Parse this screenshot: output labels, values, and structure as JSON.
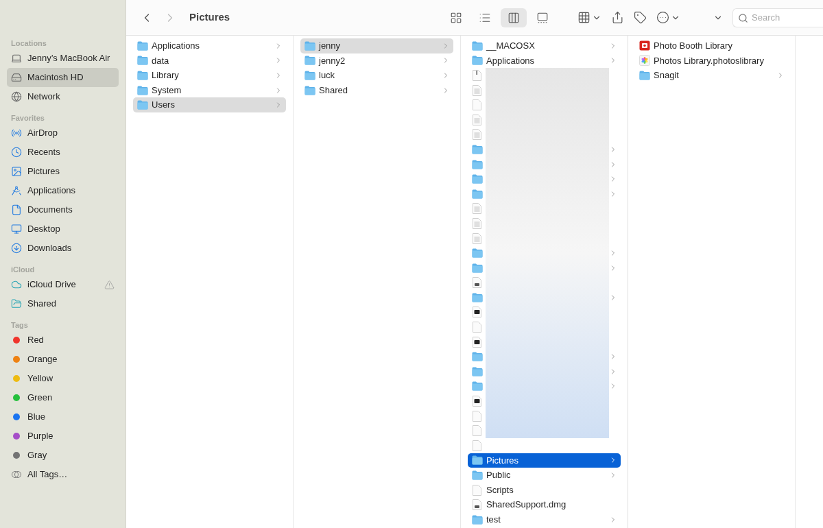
{
  "toolbar": {
    "back": {
      "disabled": false
    },
    "forward": {
      "disabled": true
    },
    "title": "Pictures",
    "views": [
      {
        "kind": "icons",
        "selected": false
      },
      {
        "kind": "list",
        "selected": false
      },
      {
        "kind": "columns",
        "selected": true
      },
      {
        "kind": "gallery",
        "selected": false
      }
    ],
    "actions": [
      {
        "kind": "group",
        "menu": true
      },
      {
        "kind": "share",
        "menu": false
      },
      {
        "kind": "tag",
        "menu": false
      },
      {
        "kind": "more",
        "menu": true
      },
      {
        "kind": "overflow",
        "menu": true
      }
    ],
    "search": {
      "placeholder": "Search"
    }
  },
  "sidebar": {
    "sections": [
      {
        "title": "Locations",
        "items": [
          {
            "label": "Jenny’s MacBook Air",
            "selected": false
          },
          {
            "label": "Macintosh HD",
            "selected": true
          },
          {
            "label": "Network",
            "selected": false
          }
        ]
      },
      {
        "title": "Favorites",
        "items": [
          {
            "label": "AirDrop",
            "selected": false
          },
          {
            "label": "Recents",
            "selected": false
          },
          {
            "label": "Pictures",
            "selected": false
          },
          {
            "label": "Applications",
            "selected": false
          },
          {
            "label": "Documents",
            "selected": false
          },
          {
            "label": "Desktop",
            "selected": false
          },
          {
            "label": "Downloads",
            "selected": false
          }
        ]
      },
      {
        "title": "iCloud",
        "items": [
          {
            "label": "iCloud Drive",
            "selected": false,
            "warning": true
          },
          {
            "label": "Shared",
            "selected": false,
            "warning": false
          }
        ]
      },
      {
        "title": "Tags",
        "items": [
          {
            "kind": "tag",
            "label": "Red",
            "color": "#f0352c",
            "selected": false
          },
          {
            "kind": "tag",
            "label": "Orange",
            "color": "#ee8212",
            "selected": false
          },
          {
            "kind": "tag",
            "label": "Yellow",
            "color": "#eebb12",
            "selected": false
          },
          {
            "kind": "tag",
            "label": "Green",
            "color": "#25c03c",
            "selected": false
          },
          {
            "kind": "tag",
            "label": "Blue",
            "color": "#1a74f0",
            "selected": false
          },
          {
            "kind": "tag",
            "label": "Purple",
            "color": "#a54ec8",
            "selected": false
          },
          {
            "kind": "tag",
            "label": "Gray",
            "color": "#737373",
            "selected": false
          },
          {
            "kind": "all",
            "label": "All Tags…",
            "selected": false
          }
        ]
      }
    ]
  },
  "columns": [
    {
      "active": false,
      "items": [
        {
          "name": "Applications",
          "kind": "folder",
          "has_children": true,
          "selected": false
        },
        {
          "name": "data",
          "kind": "folder",
          "has_children": true,
          "selected": false
        },
        {
          "name": "Library",
          "kind": "folder",
          "has_children": true,
          "selected": false
        },
        {
          "name": "System",
          "kind": "folder",
          "has_children": true,
          "selected": false
        },
        {
          "name": "Users",
          "kind": "folder",
          "has_children": true,
          "selected": true
        }
      ]
    },
    {
      "active": false,
      "items": [
        {
          "name": "jenny",
          "kind": "folder",
          "has_children": true,
          "selected": true
        },
        {
          "name": "jenny2",
          "kind": "folder",
          "has_children": true,
          "selected": false
        },
        {
          "name": "luck",
          "kind": "folder",
          "has_children": true,
          "selected": false
        },
        {
          "name": "Shared",
          "kind": "folder",
          "has_children": true,
          "selected": false
        }
      ]
    },
    {
      "active": true,
      "items": [
        {
          "name": "__MACOSX",
          "kind": "folder",
          "has_children": true,
          "selected": false
        },
        {
          "name": "Applications",
          "kind": "folder",
          "has_children": true,
          "selected": false
        },
        {
          "kind": "redacted",
          "rows": [
            {
              "kind": "archive",
              "has_children": false
            },
            {
              "kind": "text",
              "has_children": false
            },
            {
              "kind": "blank",
              "has_children": false
            },
            {
              "kind": "text",
              "has_children": false
            },
            {
              "kind": "text",
              "has_children": false
            },
            {
              "kind": "folder",
              "has_children": true
            },
            {
              "kind": "folder",
              "has_children": true
            },
            {
              "kind": "folder",
              "has_children": true
            },
            {
              "kind": "folder",
              "has_children": true
            },
            {
              "kind": "text",
              "has_children": false
            },
            {
              "kind": "text",
              "has_children": false
            },
            {
              "kind": "text",
              "has_children": false
            },
            {
              "kind": "folder",
              "has_children": true
            },
            {
              "kind": "folder",
              "has_children": true
            },
            {
              "kind": "diskimage",
              "has_children": false
            },
            {
              "kind": "folder",
              "has_children": true
            },
            {
              "kind": "app",
              "has_children": false
            },
            {
              "kind": "blank",
              "has_children": false
            },
            {
              "kind": "app",
              "has_children": false
            },
            {
              "kind": "folder",
              "has_children": true
            },
            {
              "kind": "folder",
              "has_children": true
            },
            {
              "kind": "folder",
              "has_children": true
            },
            {
              "kind": "app",
              "has_children": false
            },
            {
              "kind": "blank",
              "has_children": false
            },
            {
              "kind": "blank",
              "has_children": false
            }
          ]
        },
        {
          "kind": "blank",
          "has_children": false,
          "selected": false
        },
        {
          "name": "Pictures",
          "kind": "folder",
          "has_children": true,
          "selected": true
        },
        {
          "name": "Public",
          "kind": "folder",
          "has_children": true,
          "selected": false
        },
        {
          "name": "Scripts",
          "kind": "blank",
          "has_children": false,
          "selected": false
        },
        {
          "name": "SharedSupport.dmg",
          "kind": "diskimage",
          "has_children": false,
          "selected": false
        },
        {
          "name": "test",
          "kind": "folder",
          "has_children": true,
          "selected": false
        }
      ]
    },
    {
      "active": false,
      "items": [
        {
          "name": "Photo Booth Library",
          "kind": "photobooth",
          "has_children": false,
          "selected": false
        },
        {
          "name": "Photos Library.photoslibrary",
          "kind": "photos",
          "has_children": false,
          "selected": false
        },
        {
          "name": "Snagit",
          "kind": "folder",
          "has_children": true,
          "selected": false
        }
      ]
    }
  ]
}
